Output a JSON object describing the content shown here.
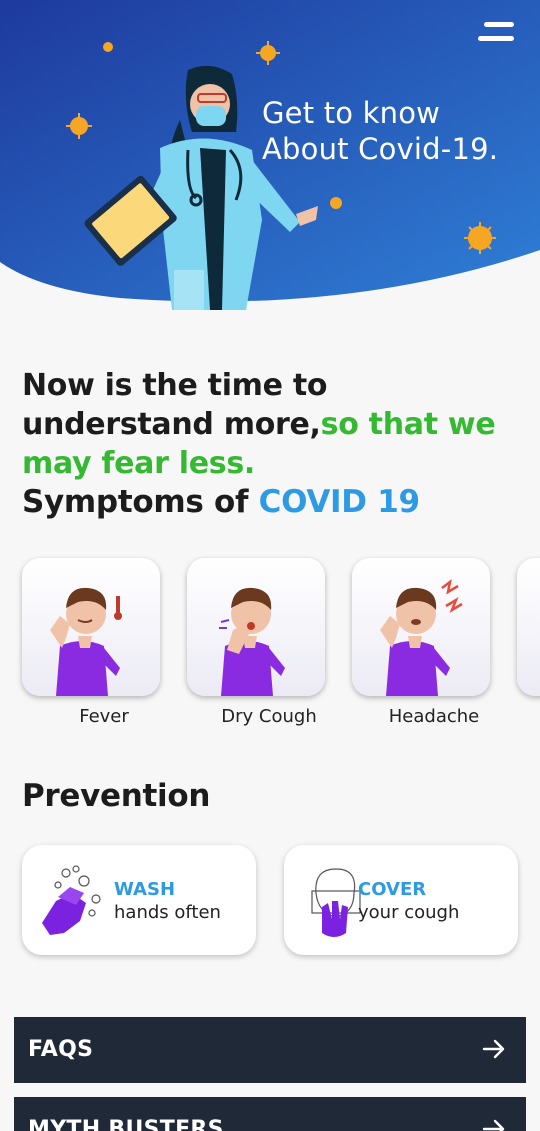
{
  "hero": {
    "title_line1": "Get to know",
    "title_line2": "About Covid-19."
  },
  "menu": {
    "icon": "hamburger-menu-icon"
  },
  "tagline": {
    "part1": "Now is the time to understand more,",
    "part2": "so that we may fear less."
  },
  "symptoms": {
    "heading_prefix": "Symptoms of ",
    "heading_highlight": "COVID 19",
    "items": [
      {
        "label": "Fever",
        "icon": "fever-illustration"
      },
      {
        "label": "Dry Cough",
        "icon": "dry-cough-illustration"
      },
      {
        "label": "Headache",
        "icon": "headache-illustration"
      }
    ]
  },
  "prevention": {
    "heading": "Prevention",
    "items": [
      {
        "title": "WASH",
        "subtitle": "hands often",
        "icon": "hand-wash-icon"
      },
      {
        "title": "COVER",
        "subtitle": "your cough",
        "icon": "cover-cough-icon"
      }
    ]
  },
  "links": [
    {
      "label": "FAQS",
      "icon": "arrow-right-icon"
    },
    {
      "label": "MYTH BUSTERS",
      "icon": "arrow-right-icon"
    }
  ],
  "colors": {
    "hero_gradient_start": "#1e3a9e",
    "hero_gradient_end": "#2f7fd6",
    "accent_blue": "#2d9ae3",
    "accent_green": "#35b832",
    "dark_bar": "#1f2937"
  }
}
